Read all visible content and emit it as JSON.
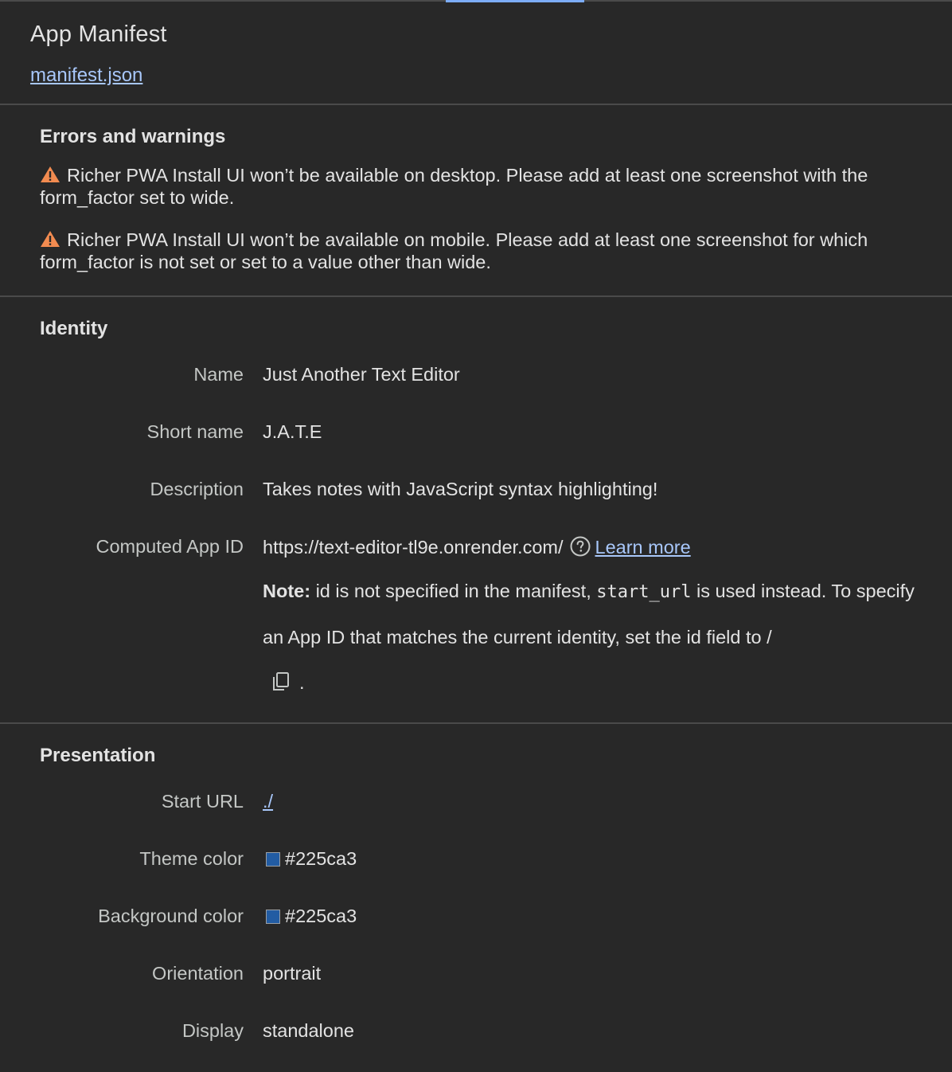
{
  "header": {
    "title": "App Manifest",
    "manifest_link": "manifest.json"
  },
  "errors": {
    "title": "Errors and warnings",
    "items": [
      {
        "icon": "warning-icon",
        "text": "Richer PWA Install UI won’t be available on desktop. Please add at least one screenshot with the form_factor set to wide."
      },
      {
        "icon": "warning-icon",
        "text": "Richer PWA Install UI won’t be available on mobile. Please add at least one screenshot for which form_factor is not set or set to a value other than wide."
      }
    ]
  },
  "identity": {
    "title": "Identity",
    "name_label": "Name",
    "name_value": "Just Another Text Editor",
    "short_name_label": "Short name",
    "short_name_value": "J.A.T.E",
    "description_label": "Description",
    "description_value": "Takes notes with JavaScript syntax highlighting!",
    "app_id_label": "Computed App ID",
    "app_id_value": "https://text-editor-tl9e.onrender.com/",
    "learn_more": "Learn more",
    "note": {
      "bold": "Note:",
      "part1": " id is not specified in the manifest, ",
      "code": "start_url",
      "part2": " is used instead. To specify an App ID that matches the current identity, set the id field to ",
      "id_value": "/",
      "end": "."
    }
  },
  "presentation": {
    "title": "Presentation",
    "start_url_label": "Start URL",
    "start_url_value": "./",
    "theme_color_label": "Theme color",
    "theme_color_value": "#225ca3",
    "background_color_label": "Background color",
    "background_color_value": "#225ca3",
    "orientation_label": "Orientation",
    "orientation_value": "portrait",
    "display_label": "Display",
    "display_value": "standalone"
  },
  "colors": {
    "background": "#282828",
    "text": "#e3e3e3",
    "label": "#c4c7c5",
    "link": "#a8c7fa",
    "warning": "#f28b50",
    "accent": "#7cacf8"
  }
}
